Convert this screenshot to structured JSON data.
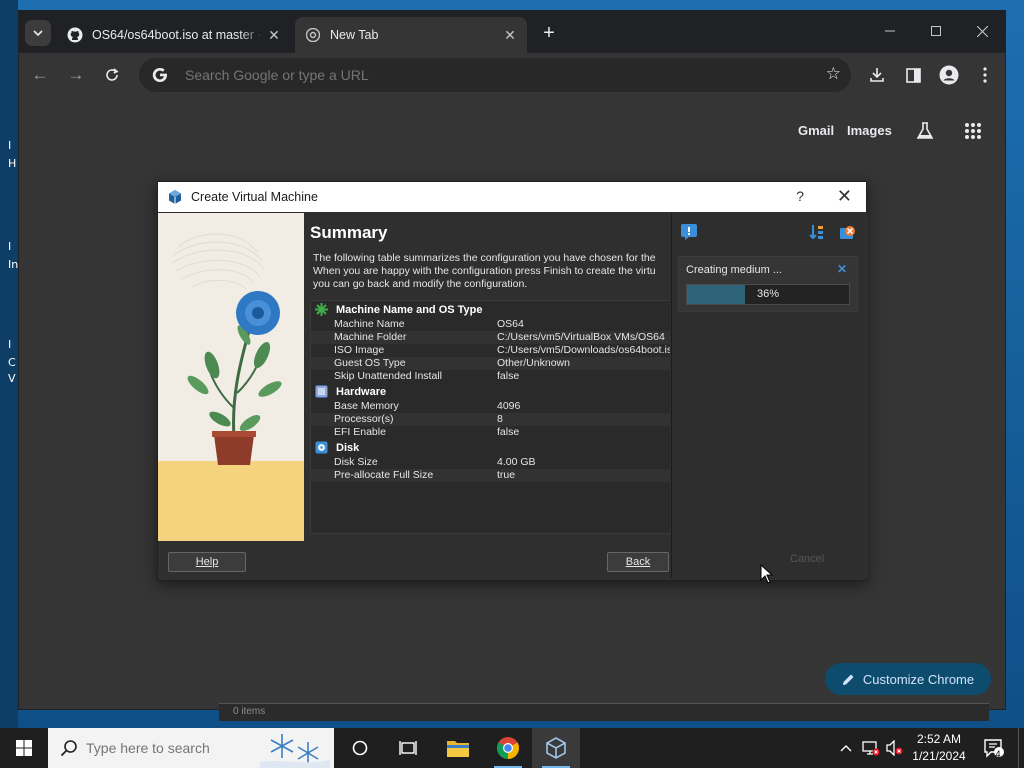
{
  "desktop": {
    "edge_chars": [
      "I",
      "H",
      "I",
      "In",
      "I",
      "C",
      "V"
    ]
  },
  "browser": {
    "tabs": [
      {
        "title": "OS64/os64boot.iso at master · ",
        "active": false
      },
      {
        "title": "New Tab",
        "active": true
      }
    ],
    "omnibox": {
      "placeholder": "Search Google or type a URL"
    },
    "ntp": {
      "gmail": "Gmail",
      "images": "Images",
      "customize": "Customize Chrome"
    },
    "peek_status": "0 items"
  },
  "dialog": {
    "title": "Create Virtual Machine",
    "help_glyph": "?",
    "heading": "Summary",
    "intro_lines": [
      "The following table summarizes the configuration you have chosen for the",
      "When you are happy with the configuration press Finish to create the virtu",
      "you can go back and modify the configuration."
    ],
    "sections": [
      {
        "title": "Machine Name and OS Type",
        "rows": [
          {
            "k": "Machine Name",
            "v": "OS64"
          },
          {
            "k": "Machine Folder",
            "v": "C:/Users/vm5/VirtualBox VMs/OS64"
          },
          {
            "k": "ISO Image",
            "v": "C:/Users/vm5/Downloads/os64boot.iso"
          },
          {
            "k": "Guest OS Type",
            "v": "Other/Unknown"
          },
          {
            "k": "Skip Unattended Install",
            "v": "false"
          }
        ]
      },
      {
        "title": "Hardware",
        "rows": [
          {
            "k": "Base Memory",
            "v": "4096"
          },
          {
            "k": "Processor(s)",
            "v": "8"
          },
          {
            "k": "EFI Enable",
            "v": "false"
          }
        ]
      },
      {
        "title": "Disk",
        "rows": [
          {
            "k": "Disk Size",
            "v": "4.00 GB"
          },
          {
            "k": "Pre-allocate Full Size",
            "v": "true"
          }
        ]
      }
    ],
    "buttons": {
      "help": "Help",
      "back": "Back"
    },
    "colors": {
      "progress_fill": "#2f6478",
      "accent": "#3b8fd8"
    }
  },
  "notification": {
    "title": "Creating medium ...",
    "progress_percent": 36,
    "progress_label": "36%",
    "cancel": "Cancel"
  },
  "taskbar": {
    "search_placeholder": "Type here to search",
    "time": "2:52 AM",
    "date": "1/21/2024",
    "notification_count": "4"
  }
}
